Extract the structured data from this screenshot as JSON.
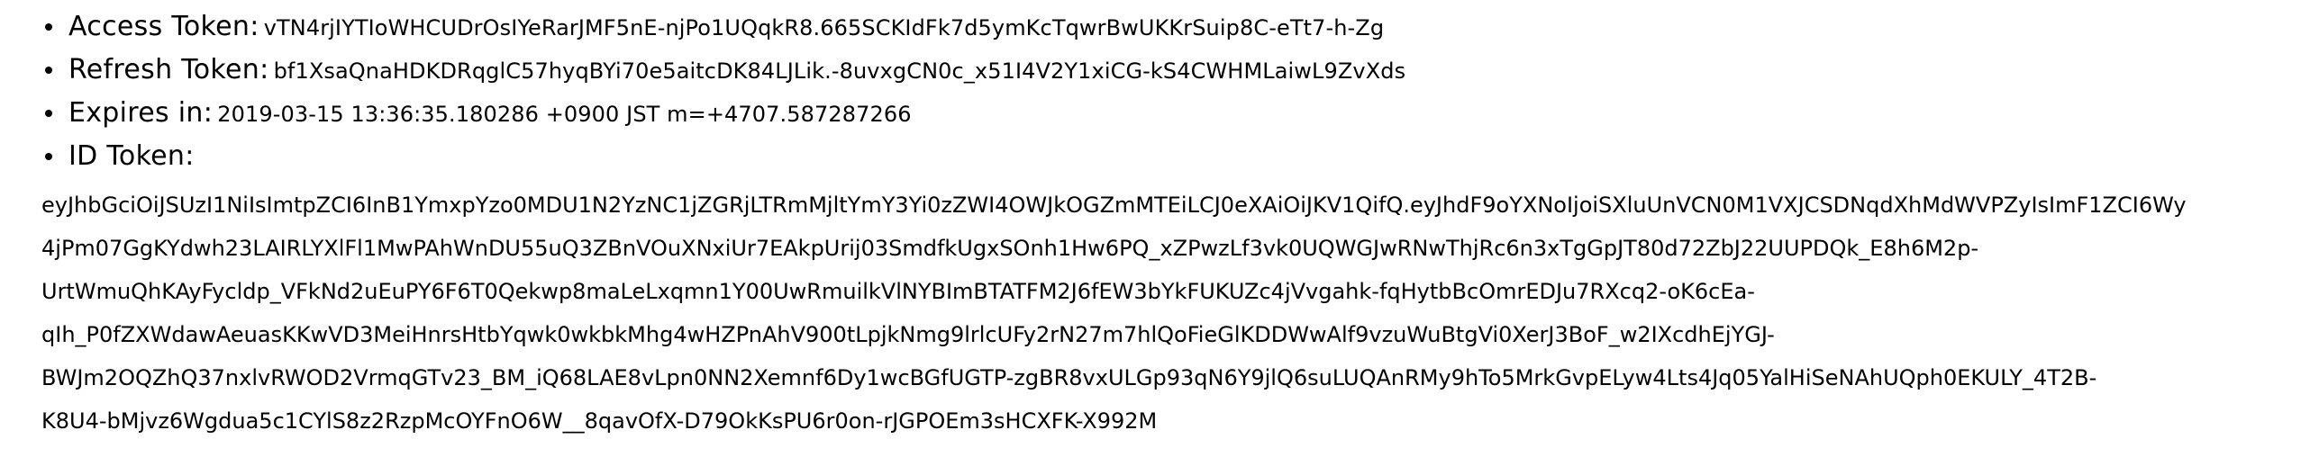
{
  "tokens": {
    "access": {
      "label": "Access Token:",
      "value": "vTN4rjIYTIoWHCUDrOsIYeRarJMF5nE-njPo1UQqkR8.665SCKIdFk7d5ymKcTqwrBwUKKrSuip8C-eTt7-h-Zg"
    },
    "refresh": {
      "label": "Refresh Token:",
      "value": "bf1XsaQnaHDKDRqglC57hyqBYi70e5aitcDK84LJLik.-8uvxgCN0c_x51I4V2Y1xiCG-kS4CWHMLaiwL9ZvXds"
    },
    "expires": {
      "label": "Expires in:",
      "value": "2019-03-15 13:36:35.180286 +0900 JST m=+4707.587287266"
    },
    "id": {
      "label": "ID Token:",
      "lines": [
        "eyJhbGciOiJSUzI1NiIsImtpZCI6InB1YmxpYzo0MDU1N2YzNC1jZGRjLTRmMjltYmY3Yi0zZWI4OWJkOGZmMTEiLCJ0eXAiOiJKV1QifQ.eyJhdF9oYXNoIjoiSXluUnVCN0M1VXJCSDNqdXhMdWVPZyIsImF1ZCI6Wy",
        "4jPm07GgKYdwh23LAIRLYXlFl1MwPAhWnDU55uQ3ZBnVOuXNxiUr7EAkpUrij03SmdfkUgxSOnh1Hw6PQ_xZPwzLf3vk0UQWGJwRNwThjRc6n3xTgGpJT80d72ZbJ22UUPDQk_E8h6M2p-",
        "UrtWmuQhKAyFycldp_VFkNd2uEuPY6F6T0Qekwp8maLeLxqmn1Y00UwRmuilkVlNYBImBTATFM2J6fEW3bYkFUKUZc4jVvgahk-fqHytbBcOmrEDJu7RXcq2-oK6cEa-",
        "qIh_P0fZXWdawAeuasKKwVD3MeiHnrsHtbYqwk0wkbkMhg4wHZPnAhV900tLpjkNmg9lrlcUFy2rN27m7hlQoFieGlKDDWwAlf9vzuWuBtgVi0XerJ3BoF_w2IXcdhEjYGJ-",
        "BWJm2OQZhQ37nxlvRWOD2VrmqGTv23_BM_iQ68LAE8vLpn0NN2Xemnf6Dy1wcBGfUGTP-zgBR8vxULGp93qN6Y9jlQ6suLUQAnRMy9hTo5MrkGvpELyw4Lts4Jq05YalHiSeNAhUQph0EKULY_4T2B-",
        "K8U4-bMjvz6Wgdua5c1CYlS8z2RzpMcOYFnO6W__8qavOfX-D79OkKsPU6r0on-rJGPOEm3sHCXFK-X992M"
      ]
    }
  }
}
